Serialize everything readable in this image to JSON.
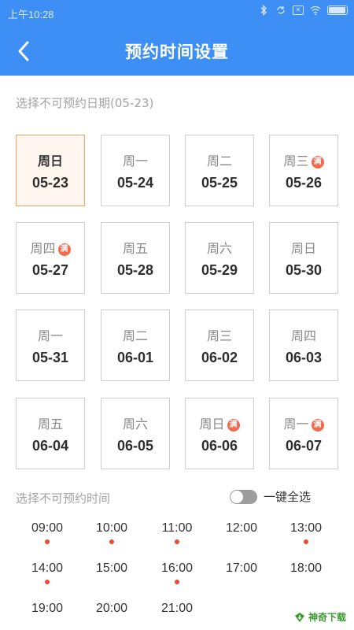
{
  "status_bar": {
    "time": "上午10:28",
    "icons": [
      "bluetooth-icon",
      "data-sync-icon",
      "sim-icon",
      "wifi-icon",
      "battery-icon"
    ]
  },
  "header": {
    "title": "预约时间设置",
    "back_icon": "chevron-left-icon",
    "bg_color": "#3d8ff5"
  },
  "dates_section": {
    "label": "选择不可预约日期(05-23)",
    "full_badge": "满",
    "cells": [
      {
        "weekday": "周日",
        "date": "05-23",
        "selected": true,
        "full": false
      },
      {
        "weekday": "周一",
        "date": "05-24",
        "selected": false,
        "full": false
      },
      {
        "weekday": "周二",
        "date": "05-25",
        "selected": false,
        "full": false
      },
      {
        "weekday": "周三",
        "date": "05-26",
        "selected": false,
        "full": true
      },
      {
        "weekday": "周四",
        "date": "05-27",
        "selected": false,
        "full": true
      },
      {
        "weekday": "周五",
        "date": "05-28",
        "selected": false,
        "full": false
      },
      {
        "weekday": "周六",
        "date": "05-29",
        "selected": false,
        "full": false
      },
      {
        "weekday": "周日",
        "date": "05-30",
        "selected": false,
        "full": false
      },
      {
        "weekday": "周一",
        "date": "05-31",
        "selected": false,
        "full": false
      },
      {
        "weekday": "周二",
        "date": "06-01",
        "selected": false,
        "full": false
      },
      {
        "weekday": "周三",
        "date": "06-02",
        "selected": false,
        "full": false
      },
      {
        "weekday": "周四",
        "date": "06-03",
        "selected": false,
        "full": false
      },
      {
        "weekday": "周五",
        "date": "06-04",
        "selected": false,
        "full": false
      },
      {
        "weekday": "周六",
        "date": "06-05",
        "selected": false,
        "full": false
      },
      {
        "weekday": "周日",
        "date": "06-06",
        "selected": false,
        "full": true
      },
      {
        "weekday": "周一",
        "date": "06-07",
        "selected": false,
        "full": true
      }
    ]
  },
  "times_section": {
    "label": "选择不可预约时间",
    "select_all_label": "一键全选",
    "select_all_on": false,
    "slots": [
      {
        "time": "09:00",
        "dot": true
      },
      {
        "time": "10:00",
        "dot": true
      },
      {
        "time": "11:00",
        "dot": true
      },
      {
        "time": "12:00",
        "dot": false
      },
      {
        "time": "13:00",
        "dot": true
      },
      {
        "time": "14:00",
        "dot": true
      },
      {
        "time": "15:00",
        "dot": false
      },
      {
        "time": "16:00",
        "dot": true
      },
      {
        "time": "17:00",
        "dot": false
      },
      {
        "time": "18:00",
        "dot": false
      },
      {
        "time": "19:00",
        "dot": false
      },
      {
        "time": "20:00",
        "dot": false
      },
      {
        "time": "21:00",
        "dot": false
      }
    ]
  },
  "watermark": {
    "text": "神奇下载",
    "color": "#3a9a2f"
  }
}
